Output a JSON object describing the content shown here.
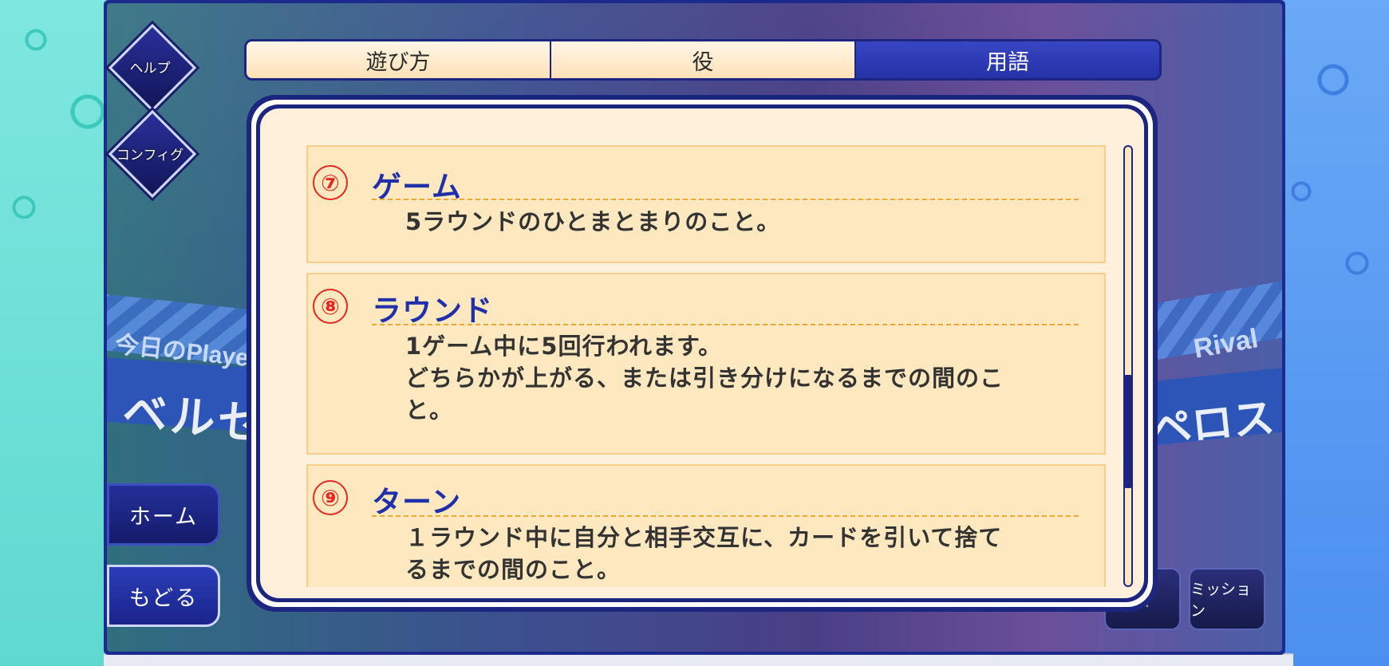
{
  "background": {
    "player_label": "今日のPlayer",
    "player_name": "ベルゼ",
    "rival_label": "Rival",
    "rival_name": "ペロス"
  },
  "side": {
    "help_label": "ヘルプ",
    "config_label": "コンフィグ",
    "home_label": "ホーム",
    "back_label": "もどる"
  },
  "corner": {
    "partial_label": "所",
    "mission_label": "ミッション"
  },
  "tabs": [
    {
      "label": "遊び方",
      "active": false
    },
    {
      "label": "役",
      "active": false
    },
    {
      "label": "用語",
      "active": true
    }
  ],
  "entries": [
    {
      "number": "⑦",
      "title": "ゲーム",
      "description": [
        "5ラウンドのひとまとまりのこと。"
      ]
    },
    {
      "number": "⑧",
      "title": "ラウンド",
      "description": [
        "1ゲーム中に5回行われます。",
        "どちらかが上がる、または引き分けになるまでの間のこ",
        "と。"
      ]
    },
    {
      "number": "⑨",
      "title": "ターン",
      "description": [
        "１ラウンド中に自分と相手交互に、カードを引いて捨て",
        "るまでの間のこと。"
      ]
    }
  ],
  "colors": {
    "accent_blue": "#1c2680",
    "number_red": "#e8281e",
    "title_blue": "#2030a8",
    "entry_bg": "#fde8bf"
  },
  "scroll": {
    "position_fraction": 0.7
  }
}
